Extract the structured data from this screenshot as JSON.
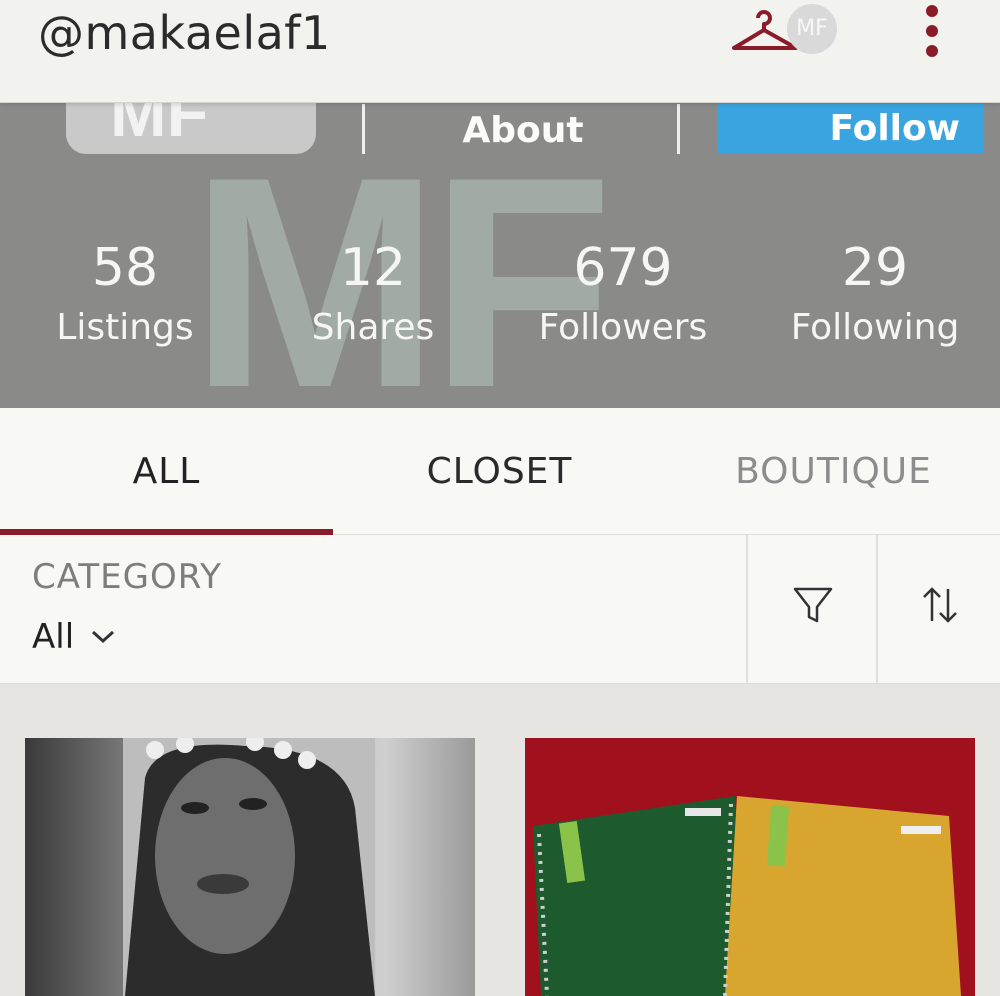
{
  "header": {
    "username": "@makaelaf1",
    "avatar_initials": "MF",
    "icons": {
      "closet": "hanger-icon",
      "menu": "kebab-menu-icon"
    },
    "accent_color": "#8a1c2a"
  },
  "profile": {
    "banner_watermark": "MF",
    "avatar_initials": "MF",
    "about_label": "About",
    "follow_label": "Follow",
    "follow_color": "#3aa4e0",
    "stats": [
      {
        "value": "58",
        "label": "Listings"
      },
      {
        "value": "12",
        "label": "Shares"
      },
      {
        "value": "679",
        "label": "Followers"
      },
      {
        "value": "29",
        "label": "Following"
      }
    ]
  },
  "tabs": [
    {
      "label": "ALL",
      "active": true
    },
    {
      "label": "CLOSET",
      "active": false
    },
    {
      "label": "BOUTIQUE",
      "active": false
    }
  ],
  "filters": {
    "category_label": "CATEGORY",
    "category_value": "All",
    "icons": {
      "filter": "funnel-icon",
      "sort": "sort-arrows-icon",
      "dropdown": "chevron-down-icon"
    }
  },
  "listings": [
    {
      "image": "portrait-photo"
    },
    {
      "image": "notebooks-photo"
    }
  ]
}
